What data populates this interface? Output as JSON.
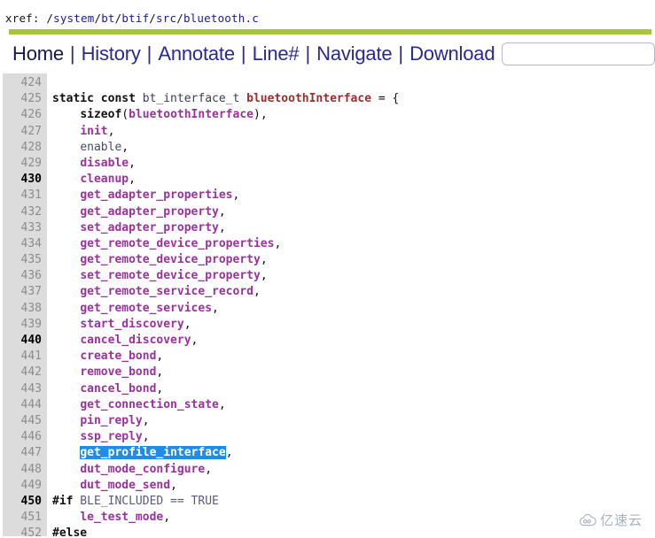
{
  "header": {
    "label": "xref:",
    "path_prefix": "/",
    "path_segments": [
      "system",
      "bt",
      "btif",
      "src",
      "bluetooth.c"
    ],
    "full_path": "xref: /system/bt/btif/src/bluetooth.c"
  },
  "menu": {
    "items": [
      {
        "label": "Home",
        "name": "nav-home"
      },
      {
        "label": "History",
        "name": "nav-history"
      },
      {
        "label": "Annotate",
        "name": "nav-annotate"
      },
      {
        "label": "Line#",
        "name": "nav-line-number"
      },
      {
        "label": "Navigate",
        "name": "nav-navigate"
      },
      {
        "label": "Download",
        "name": "nav-download"
      }
    ],
    "separator": "|",
    "search": {
      "value": "",
      "placeholder": ""
    }
  },
  "colors": {
    "rule_green": "#a6c53c",
    "gutter_gray": "#dcdcdc",
    "nav_link": "#2a2a8c",
    "symbol_purple": "#99339b",
    "declaration_red": "#9b2d2d",
    "selection_blue": "#1f8ce8",
    "watermark_gray": "#9aa3ad"
  },
  "code": {
    "first_line": 424,
    "selected_line": 447,
    "selected_text": "get_profile_interface",
    "lines": [
      {
        "n": "424",
        "tokens": []
      },
      {
        "n": "425",
        "tokens": [
          {
            "t": "static const ",
            "c": "t-kw"
          },
          {
            "t": "bt_interface_t ",
            "c": "t-type"
          },
          {
            "t": "bluetoothInterface",
            "c": "t-var"
          },
          {
            "t": " = {",
            "c": "t-punct"
          }
        ]
      },
      {
        "n": "426",
        "tokens": [
          {
            "t": "    ",
            "c": "t-punct"
          },
          {
            "t": "sizeof",
            "c": "t-kw"
          },
          {
            "t": "(",
            "c": "t-punct"
          },
          {
            "t": "bluetoothInterface",
            "c": "t-sym"
          },
          {
            "t": "),",
            "c": "t-punct"
          }
        ]
      },
      {
        "n": "427",
        "tokens": [
          {
            "t": "    ",
            "c": "t-punct"
          },
          {
            "t": "init",
            "c": "t-sym"
          },
          {
            "t": ",",
            "c": "t-punct"
          }
        ]
      },
      {
        "n": "428",
        "tokens": [
          {
            "t": "    ",
            "c": "t-punct"
          },
          {
            "t": "enable",
            "c": "t-plain"
          },
          {
            "t": ",",
            "c": "t-punct"
          }
        ]
      },
      {
        "n": "429",
        "tokens": [
          {
            "t": "    ",
            "c": "t-punct"
          },
          {
            "t": "disable",
            "c": "t-sym"
          },
          {
            "t": ",",
            "c": "t-punct"
          }
        ]
      },
      {
        "n": "430",
        "tokens": [
          {
            "t": "    ",
            "c": "t-punct"
          },
          {
            "t": "cleanup",
            "c": "t-sym"
          },
          {
            "t": ",",
            "c": "t-punct"
          }
        ]
      },
      {
        "n": "431",
        "tokens": [
          {
            "t": "    ",
            "c": "t-punct"
          },
          {
            "t": "get_adapter_properties",
            "c": "t-sym"
          },
          {
            "t": ",",
            "c": "t-punct"
          }
        ]
      },
      {
        "n": "432",
        "tokens": [
          {
            "t": "    ",
            "c": "t-punct"
          },
          {
            "t": "get_adapter_property",
            "c": "t-sym"
          },
          {
            "t": ",",
            "c": "t-punct"
          }
        ]
      },
      {
        "n": "433",
        "tokens": [
          {
            "t": "    ",
            "c": "t-punct"
          },
          {
            "t": "set_adapter_property",
            "c": "t-sym"
          },
          {
            "t": ",",
            "c": "t-punct"
          }
        ]
      },
      {
        "n": "434",
        "tokens": [
          {
            "t": "    ",
            "c": "t-punct"
          },
          {
            "t": "get_remote_device_properties",
            "c": "t-sym"
          },
          {
            "t": ",",
            "c": "t-punct"
          }
        ]
      },
      {
        "n": "435",
        "tokens": [
          {
            "t": "    ",
            "c": "t-punct"
          },
          {
            "t": "get_remote_device_property",
            "c": "t-sym"
          },
          {
            "t": ",",
            "c": "t-punct"
          }
        ]
      },
      {
        "n": "436",
        "tokens": [
          {
            "t": "    ",
            "c": "t-punct"
          },
          {
            "t": "set_remote_device_property",
            "c": "t-sym"
          },
          {
            "t": ",",
            "c": "t-punct"
          }
        ]
      },
      {
        "n": "437",
        "tokens": [
          {
            "t": "    ",
            "c": "t-punct"
          },
          {
            "t": "get_remote_service_record",
            "c": "t-sym"
          },
          {
            "t": ",",
            "c": "t-punct"
          }
        ]
      },
      {
        "n": "438",
        "tokens": [
          {
            "t": "    ",
            "c": "t-punct"
          },
          {
            "t": "get_remote_services",
            "c": "t-sym"
          },
          {
            "t": ",",
            "c": "t-punct"
          }
        ]
      },
      {
        "n": "439",
        "tokens": [
          {
            "t": "    ",
            "c": "t-punct"
          },
          {
            "t": "start_discovery",
            "c": "t-sym"
          },
          {
            "t": ",",
            "c": "t-punct"
          }
        ]
      },
      {
        "n": "440",
        "tokens": [
          {
            "t": "    ",
            "c": "t-punct"
          },
          {
            "t": "cancel_discovery",
            "c": "t-sym"
          },
          {
            "t": ",",
            "c": "t-punct"
          }
        ]
      },
      {
        "n": "441",
        "tokens": [
          {
            "t": "    ",
            "c": "t-punct"
          },
          {
            "t": "create_bond",
            "c": "t-sym"
          },
          {
            "t": ",",
            "c": "t-punct"
          }
        ]
      },
      {
        "n": "442",
        "tokens": [
          {
            "t": "    ",
            "c": "t-punct"
          },
          {
            "t": "remove_bond",
            "c": "t-sym"
          },
          {
            "t": ",",
            "c": "t-punct"
          }
        ]
      },
      {
        "n": "443",
        "tokens": [
          {
            "t": "    ",
            "c": "t-punct"
          },
          {
            "t": "cancel_bond",
            "c": "t-sym"
          },
          {
            "t": ",",
            "c": "t-punct"
          }
        ]
      },
      {
        "n": "444",
        "tokens": [
          {
            "t": "    ",
            "c": "t-punct"
          },
          {
            "t": "get_connection_state",
            "c": "t-sym"
          },
          {
            "t": ",",
            "c": "t-punct"
          }
        ]
      },
      {
        "n": "445",
        "tokens": [
          {
            "t": "    ",
            "c": "t-punct"
          },
          {
            "t": "pin_reply",
            "c": "t-sym"
          },
          {
            "t": ",",
            "c": "t-punct"
          }
        ]
      },
      {
        "n": "446",
        "tokens": [
          {
            "t": "    ",
            "c": "t-punct"
          },
          {
            "t": "ssp_reply",
            "c": "t-sym"
          },
          {
            "t": ",",
            "c": "t-punct"
          }
        ]
      },
      {
        "n": "447",
        "tokens": [
          {
            "t": "    ",
            "c": "t-punct"
          },
          {
            "t": "get_profile_interface",
            "c": "t-sel"
          },
          {
            "t": ",",
            "c": "t-punct"
          }
        ]
      },
      {
        "n": "448",
        "tokens": [
          {
            "t": "    ",
            "c": "t-punct"
          },
          {
            "t": "dut_mode_configure",
            "c": "t-sym"
          },
          {
            "t": ",",
            "c": "t-punct"
          }
        ]
      },
      {
        "n": "449",
        "tokens": [
          {
            "t": "    ",
            "c": "t-punct"
          },
          {
            "t": "dut_mode_send",
            "c": "t-sym"
          },
          {
            "t": ",",
            "c": "t-punct"
          }
        ]
      },
      {
        "n": "450",
        "tokens": [
          {
            "t": "#if",
            "c": "t-kw"
          },
          {
            "t": " BLE_INCLUDED == TRUE",
            "c": "t-macro"
          }
        ]
      },
      {
        "n": "451",
        "tokens": [
          {
            "t": "    ",
            "c": "t-punct"
          },
          {
            "t": "le_test_mode",
            "c": "t-sym"
          },
          {
            "t": ",",
            "c": "t-punct"
          }
        ]
      },
      {
        "n": "452",
        "tokens": [
          {
            "t": "#else",
            "c": "t-kw"
          }
        ]
      }
    ]
  },
  "watermark": {
    "text": "亿速云",
    "icon": "cloud-icon"
  }
}
